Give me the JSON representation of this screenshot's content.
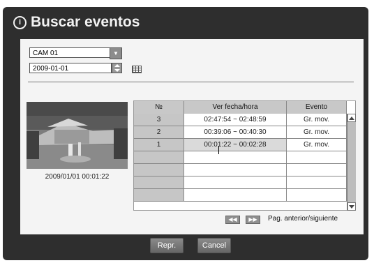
{
  "dialog": {
    "title": "Buscar eventos",
    "title_icon": "info-circle-icon"
  },
  "camera_select": {
    "value": "CAM 01"
  },
  "date_field": {
    "value": "2009-01-01"
  },
  "preview": {
    "timestamp": "2009/01/01  00:01:22"
  },
  "event_table": {
    "columns": [
      "№",
      "Ver fecha/hora",
      "Evento"
    ],
    "rows": [
      {
        "num": "3",
        "time": "02:47:54 ~ 02:48:59",
        "event": "Gr. mov."
      },
      {
        "num": "2",
        "time": "00:39:06 ~ 00:40:30",
        "event": "Gr. mov."
      },
      {
        "num": "1",
        "time": "00:01:22 ~ 00:02:28",
        "event": "Gr. mov."
      }
    ],
    "selected_row": 2
  },
  "pager": {
    "prev_icon": "double-left-icon",
    "next_icon": "double-right-icon",
    "label": "Pag. anterior/siguiente"
  },
  "buttons": {
    "play": "Repr.",
    "cancel": "Cancel"
  },
  "colors": {
    "frame": "#2e2e2e",
    "panel": "#f4f4f4",
    "header": "#c8c8c8",
    "button": "#777777"
  }
}
